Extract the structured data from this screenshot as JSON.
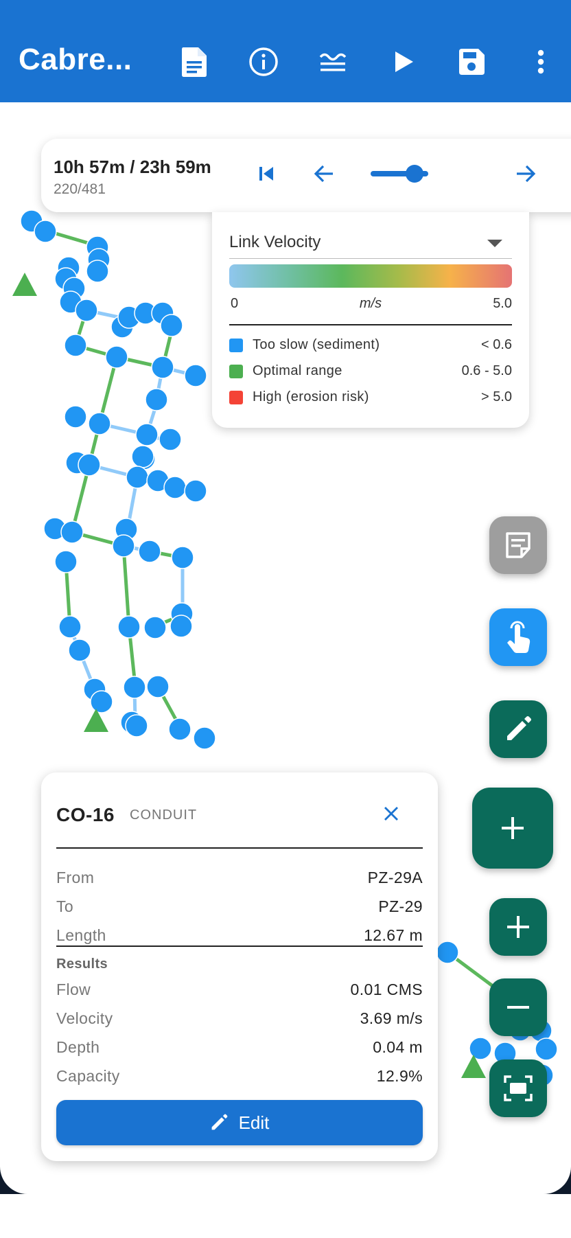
{
  "appbar": {
    "title": "Cabre...",
    "icons": [
      "report-icon",
      "info-icon",
      "layers-icon",
      "play-icon",
      "save-icon",
      "more-vert-icon"
    ]
  },
  "simulation": {
    "time": "10h 57m / 23h 59m",
    "step": "220/481",
    "slider_fraction": 0.46
  },
  "legend": {
    "selected_layer": "Link Velocity",
    "scale_min": "0",
    "scale_unit": "m/s",
    "scale_max": "5.0",
    "items": [
      {
        "label": "Too slow (sediment)",
        "value": "< 0.6",
        "color": "#2196f3"
      },
      {
        "label": "Optimal range",
        "value": "0.6 - 5.0",
        "color": "#4caf50"
      },
      {
        "label": "High (erosion risk)",
        "value": "> 5.0",
        "color": "#f44336"
      }
    ]
  },
  "colors": {
    "primary": "#1a73d1",
    "node": "#2196f3",
    "link_slow": "#90caf9",
    "link_optimal": "#5cb85c",
    "outfall": "#4caf50",
    "fab_green": "#0b6b5a",
    "fab_blue": "#2196f3",
    "fab_grey": "#9e9e9e"
  },
  "details": {
    "id": "CO-16",
    "type": "CONDUIT",
    "props": [
      {
        "label": "From",
        "value": "PZ-29A"
      },
      {
        "label": "To",
        "value": "PZ-29"
      },
      {
        "label": "Length",
        "value": "12.67 m"
      }
    ],
    "results_title": "Results",
    "results": [
      {
        "label": "Flow",
        "value": "0.01 CMS"
      },
      {
        "label": "Velocity",
        "value": "3.69 m/s"
      },
      {
        "label": "Depth",
        "value": "0.04 m"
      },
      {
        "label": "Capacity",
        "value": "12.9%"
      }
    ],
    "edit_label": "Edit"
  }
}
